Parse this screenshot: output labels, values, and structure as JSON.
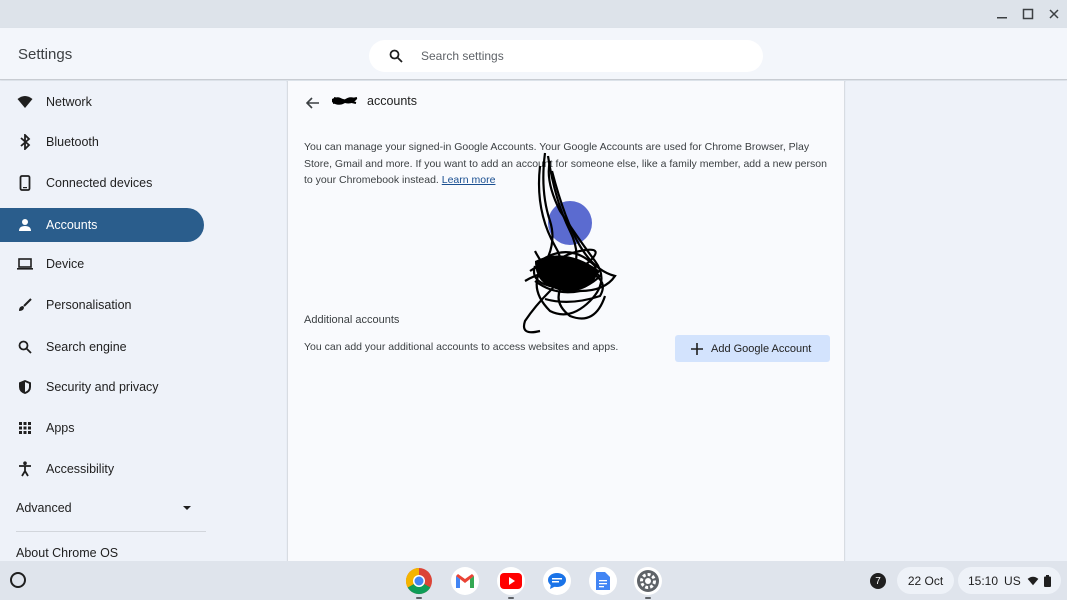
{
  "window": {
    "minimize_icon": "minimize-icon",
    "maximize_icon": "maximize-icon",
    "close_icon": "close-icon"
  },
  "header": {
    "title": "Settings",
    "search_placeholder": "Search settings"
  },
  "sidebar": {
    "items": [
      {
        "label": "Network",
        "icon": "wifi-icon"
      },
      {
        "label": "Bluetooth",
        "icon": "bluetooth-icon"
      },
      {
        "label": "Connected devices",
        "icon": "phone-icon"
      },
      {
        "label": "Accounts",
        "icon": "person-icon",
        "active": true
      },
      {
        "label": "Device",
        "icon": "laptop-icon"
      },
      {
        "label": "Personalisation",
        "icon": "brush-icon"
      },
      {
        "label": "Search engine",
        "icon": "search-icon"
      },
      {
        "label": "Security and privacy",
        "icon": "shield-icon"
      },
      {
        "label": "Apps",
        "icon": "grid-icon"
      },
      {
        "label": "Accessibility",
        "icon": "accessibility-icon"
      }
    ],
    "advanced_label": "Advanced",
    "about_label": "About Chrome OS"
  },
  "main": {
    "title": "accounts",
    "description": "You can manage your signed-in Google Accounts. Your Google Accounts are used for Chrome Browser, Play Store, Gmail and more. If you want to add an account for someone else, like a family member, add a new person to your Chromebook instead.",
    "learn_more": "Learn more",
    "additional_title": "Additional accounts",
    "additional_desc": "You can add your additional accounts to access websites and apps.",
    "add_button": "Add Google Account"
  },
  "shelf": {
    "apps": [
      "chrome-icon",
      "gmail-icon",
      "youtube-icon",
      "messages-icon",
      "docs-icon",
      "settings-icon"
    ],
    "notification_count": "7",
    "date": "22 Oct",
    "time": "15:10",
    "locale": "US"
  },
  "colors": {
    "accent": "#2a5d8c",
    "button_bg": "#d3e3fd",
    "avatar": "#5b6bd0"
  }
}
